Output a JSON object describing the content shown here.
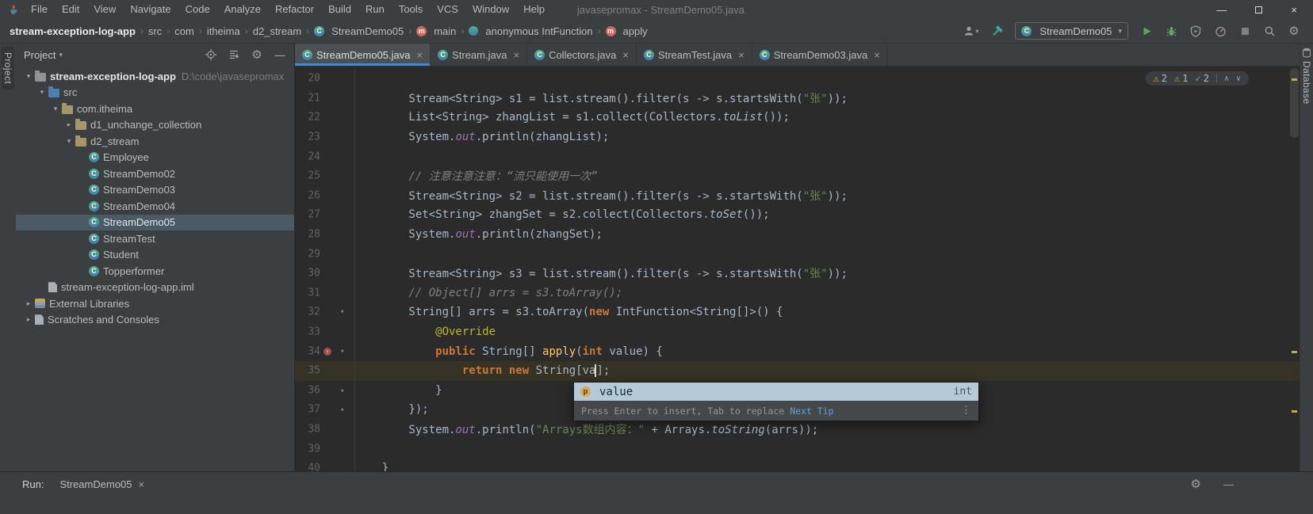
{
  "colors": {
    "panel_bg": "#3c3f41",
    "editor_bg": "#2b2b2b",
    "accent_blue": "#4a88c7",
    "keyword_orange": "#cc7832",
    "string_green": "#6a8759",
    "comment_gray": "#808080",
    "annotation_yellow": "#bbb529",
    "warning_yellow": "#d9a74a",
    "run_green": "#5ca75b"
  },
  "icons": {
    "chevron_down": "▾",
    "chevron_right": "▸",
    "fold_down": "▾",
    "fold_up": "▴",
    "separator": "›",
    "close": "×",
    "minimize": "—",
    "gear": "⚙",
    "warning": "⚠",
    "check": "✓",
    "arrow_up": "∧",
    "arrow_down": "∨",
    "more_dots": "⋮",
    "override_arrow": "↑"
  },
  "menu_bar": {
    "menus": [
      "File",
      "Edit",
      "View",
      "Navigate",
      "Code",
      "Analyze",
      "Refactor",
      "Build",
      "Run",
      "Tools",
      "VCS",
      "Window",
      "Help"
    ],
    "window_title": "javasepromax - StreamDemo05.java"
  },
  "nav_bar": {
    "breadcrumbs": [
      {
        "label": "stream-exception-log-app",
        "icon": "none",
        "bold": true
      },
      {
        "label": "src",
        "icon": "none"
      },
      {
        "label": "com",
        "icon": "none"
      },
      {
        "label": "itheima",
        "icon": "none"
      },
      {
        "label": "d2_stream",
        "icon": "none"
      },
      {
        "label": "StreamDemo05",
        "icon": "class"
      },
      {
        "label": "main",
        "icon": "method"
      },
      {
        "label": "anonymous IntFunction",
        "icon": "anonymous-class"
      },
      {
        "label": "apply",
        "icon": "method"
      }
    ],
    "run_config": "StreamDemo05"
  },
  "project_panel": {
    "title": "Project",
    "tree": [
      {
        "label": "stream-exception-log-app",
        "suffix": "D:\\code\\javasepromax",
        "icon": "folder",
        "chevron": "down",
        "indent": 0,
        "bold": true
      },
      {
        "label": "src",
        "icon": "src-folder",
        "chevron": "down",
        "indent": 1
      },
      {
        "label": "com.itheima",
        "icon": "package",
        "chevron": "down",
        "indent": 2
      },
      {
        "label": "d1_unchange_collection",
        "icon": "package",
        "chevron": "right",
        "indent": 3
      },
      {
        "label": "d2_stream",
        "icon": "package",
        "chevron": "down",
        "indent": 3
      },
      {
        "label": "Employee",
        "icon": "class",
        "indent": 4
      },
      {
        "label": "StreamDemo02",
        "icon": "class",
        "indent": 4
      },
      {
        "label": "StreamDemo03",
        "icon": "class",
        "indent": 4
      },
      {
        "label": "StreamDemo04",
        "icon": "class",
        "indent": 4
      },
      {
        "label": "StreamDemo05",
        "icon": "class",
        "indent": 4,
        "selected": true
      },
      {
        "label": "StreamTest",
        "icon": "class",
        "indent": 4
      },
      {
        "label": "Student",
        "icon": "class",
        "indent": 4
      },
      {
        "label": "Topperformer",
        "icon": "class",
        "indent": 4
      },
      {
        "label": "stream-exception-log-app.iml",
        "icon": "file",
        "indent": 1
      },
      {
        "label": "External Libraries",
        "icon": "library",
        "chevron": "right",
        "indent": 0
      },
      {
        "label": "Scratches and Consoles",
        "icon": "scratch",
        "chevron": "right",
        "indent": 0
      }
    ]
  },
  "editor": {
    "tabs": [
      {
        "label": "StreamDemo05.java",
        "active": true
      },
      {
        "label": "Stream.java"
      },
      {
        "label": "Collectors.java"
      },
      {
        "label": "StreamTest.java"
      },
      {
        "label": "StreamDemo03.java"
      }
    ],
    "inspections": {
      "warnings": "2",
      "weak_warnings": "1",
      "typos": "2"
    },
    "completion": {
      "label": "value",
      "type": "int",
      "hint": "Press Enter to insert, Tab to replace",
      "link": "Next Tip"
    },
    "lines": [
      {
        "n": "20",
        "seg": []
      },
      {
        "n": "21",
        "seg": [
          {
            "s": "d",
            "t": "        Stream<String> s1 = list.stream().filter(s -> s.startsWith("
          },
          {
            "s": "s",
            "t": "\"张\""
          },
          {
            "s": "d",
            "t": "));"
          }
        ]
      },
      {
        "n": "22",
        "seg": [
          {
            "s": "d",
            "t": "        List<String> zhangList = s1.collect(Collectors."
          },
          {
            "s": "i",
            "t": "toList"
          },
          {
            "s": "d",
            "t": "());"
          }
        ]
      },
      {
        "n": "23",
        "seg": [
          {
            "s": "d",
            "t": "        System."
          },
          {
            "s": "f",
            "t": "out"
          },
          {
            "s": "d",
            "t": ".println(zhangList);"
          }
        ]
      },
      {
        "n": "24",
        "seg": []
      },
      {
        "n": "25",
        "seg": [
          {
            "s": "c",
            "t": "        // 注意注意注意：“流只能使用一次”"
          }
        ]
      },
      {
        "n": "26",
        "seg": [
          {
            "s": "d",
            "t": "        Stream<String> s2 = list.stream().filter(s -> s.startsWith("
          },
          {
            "s": "s",
            "t": "\"张\""
          },
          {
            "s": "d",
            "t": "));"
          }
        ]
      },
      {
        "n": "27",
        "seg": [
          {
            "s": "d",
            "t": "        Set<String> zhangSet = s2.collect(Collectors."
          },
          {
            "s": "i",
            "t": "toSet"
          },
          {
            "s": "d",
            "t": "());"
          }
        ]
      },
      {
        "n": "28",
        "seg": [
          {
            "s": "d",
            "t": "        System."
          },
          {
            "s": "f",
            "t": "out"
          },
          {
            "s": "d",
            "t": ".println(zhangSet);"
          }
        ]
      },
      {
        "n": "29",
        "seg": []
      },
      {
        "n": "30",
        "seg": [
          {
            "s": "d",
            "t": "        Stream<String> s3 = list.stream().filter(s -> s.startsWith("
          },
          {
            "s": "s",
            "t": "\"张\""
          },
          {
            "s": "d",
            "t": "));"
          }
        ]
      },
      {
        "n": "31",
        "seg": [
          {
            "s": "c",
            "t": "        // Object[] arrs = s3.toArray();"
          }
        ]
      },
      {
        "n": "32",
        "fold": "down",
        "seg": [
          {
            "s": "d",
            "t": "        String[] arrs = s3.toArray("
          },
          {
            "s": "k",
            "t": "new"
          },
          {
            "s": "d",
            "t": " IntFunction<String[]>() {"
          }
        ]
      },
      {
        "n": "33",
        "seg": [
          {
            "s": "a",
            "t": "            @Override"
          }
        ]
      },
      {
        "n": "34",
        "override": true,
        "fold": "down",
        "seg": [
          {
            "s": "d",
            "t": "            "
          },
          {
            "s": "k",
            "t": "public"
          },
          {
            "s": "d",
            "t": " String[] "
          },
          {
            "s": "m",
            "t": "apply"
          },
          {
            "s": "d",
            "t": "("
          },
          {
            "s": "k",
            "t": "int"
          },
          {
            "s": "d",
            "t": " value) {"
          }
        ]
      },
      {
        "n": "35",
        "current": true,
        "seg": [
          {
            "s": "d",
            "t": "                "
          },
          {
            "s": "k",
            "t": "return"
          },
          {
            "s": "d",
            "t": " "
          },
          {
            "s": "k",
            "t": "new"
          },
          {
            "s": "d",
            "t": " String["
          },
          {
            "s": "d",
            "t": "va"
          },
          {
            "s": "caret",
            "t": ""
          },
          {
            "s": "d",
            "t": "];"
          }
        ]
      },
      {
        "n": "36",
        "fold": "up",
        "seg": [
          {
            "s": "d",
            "t": "            }"
          }
        ]
      },
      {
        "n": "37",
        "fold": "up",
        "seg": [
          {
            "s": "d",
            "t": "        });"
          }
        ]
      },
      {
        "n": "38",
        "seg": [
          {
            "s": "d",
            "t": "        System."
          },
          {
            "s": "f",
            "t": "out"
          },
          {
            "s": "d",
            "t": ".println("
          },
          {
            "s": "s",
            "t": "\"Arrays数组内容：\""
          },
          {
            "s": "d",
            "t": " + Arrays."
          },
          {
            "s": "i",
            "t": "toString"
          },
          {
            "s": "d",
            "t": "(arrs));"
          }
        ]
      },
      {
        "n": "39",
        "seg": []
      },
      {
        "n": "40",
        "seg": [
          {
            "s": "d",
            "t": "    }"
          }
        ]
      }
    ]
  },
  "bottom_bar": {
    "run_label": "Run:",
    "tab_label": "StreamDemo05"
  },
  "tool_strips": {
    "left": "Project",
    "right": "Database"
  }
}
